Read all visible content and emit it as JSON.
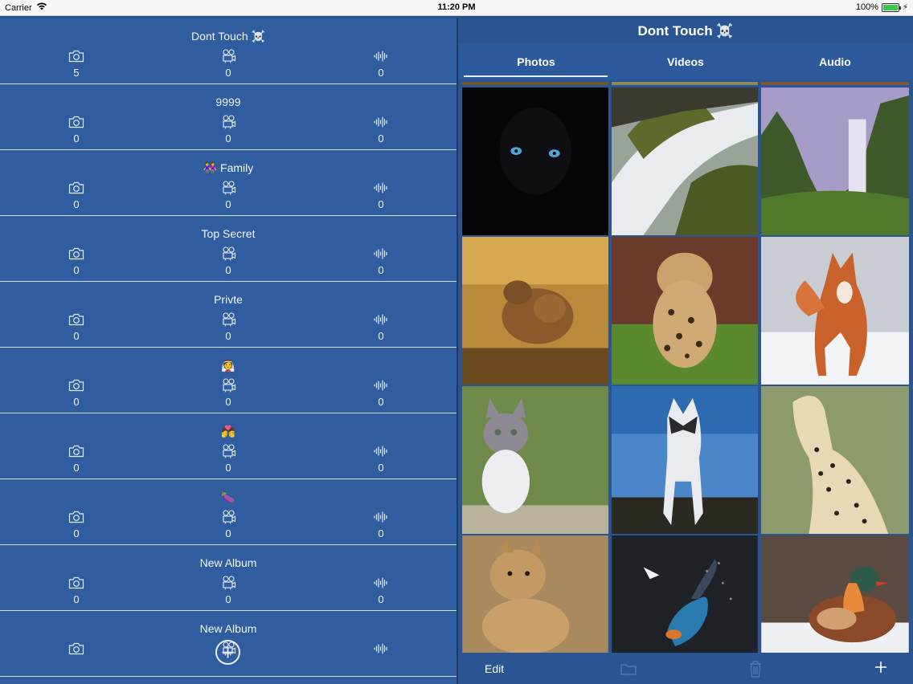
{
  "statusbar": {
    "carrier": "Carrier",
    "time": "11:20 PM",
    "battery": "100%",
    "battery_level": 1.0
  },
  "albums": [
    {
      "name": "Dont Touch ☠️",
      "photos": "5",
      "videos": "0",
      "audio": "0"
    },
    {
      "name": "9999",
      "photos": "0",
      "videos": "0",
      "audio": "0"
    },
    {
      "name": "👭 Family",
      "photos": "0",
      "videos": "0",
      "audio": "0"
    },
    {
      "name": "Top Secret",
      "photos": "0",
      "videos": "0",
      "audio": "0"
    },
    {
      "name": "Privte",
      "photos": "0",
      "videos": "0",
      "audio": "0"
    },
    {
      "name": "👰",
      "photos": "0",
      "videos": "0",
      "audio": "0"
    },
    {
      "name": "💏",
      "photos": "0",
      "videos": "0",
      "audio": "0"
    },
    {
      "name": "🍆",
      "photos": "0",
      "videos": "0",
      "audio": "0"
    },
    {
      "name": "New Album",
      "photos": "0",
      "videos": "0",
      "audio": "0"
    },
    {
      "name": "New Album",
      "photos": "",
      "videos": "",
      "audio": ""
    }
  ],
  "detail": {
    "title": "Dont Touch ☠️",
    "tabs": [
      "Photos",
      "Videos",
      "Audio"
    ],
    "selected_tab": "Photos"
  },
  "toolbar": {
    "edit_label": "Edit"
  },
  "icons": {
    "photo": "camera-icon",
    "video": "video-camera-icon",
    "audio": "waveform-icon",
    "add": "plus-icon",
    "folder": "folder-icon",
    "trash": "trash-icon"
  },
  "colors": {
    "accent": "#2f5da0",
    "text": "#ffffff",
    "statusbar": "#f7f7f7"
  }
}
